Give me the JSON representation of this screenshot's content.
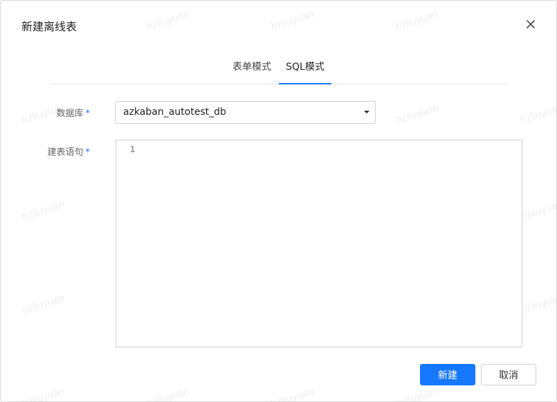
{
  "dialog": {
    "title": "新建离线表",
    "close_icon": "close-icon"
  },
  "watermark": {
    "text": "hzliuyuan"
  },
  "tabs": [
    {
      "label": "表单模式",
      "active": false
    },
    {
      "label": "SQL模式",
      "active": true
    }
  ],
  "form": {
    "database": {
      "label": "数据库",
      "required_mark": "*",
      "value": "azkaban_autotest_db",
      "icon": "caret-down-icon"
    },
    "ddl": {
      "label": "建表语句",
      "required_mark": "*",
      "line_number": "1",
      "content": ""
    }
  },
  "footer": {
    "submit_label": "新建",
    "cancel_label": "取消"
  },
  "colors": {
    "accent": "#1677ff",
    "border": "#cfcfcf"
  }
}
